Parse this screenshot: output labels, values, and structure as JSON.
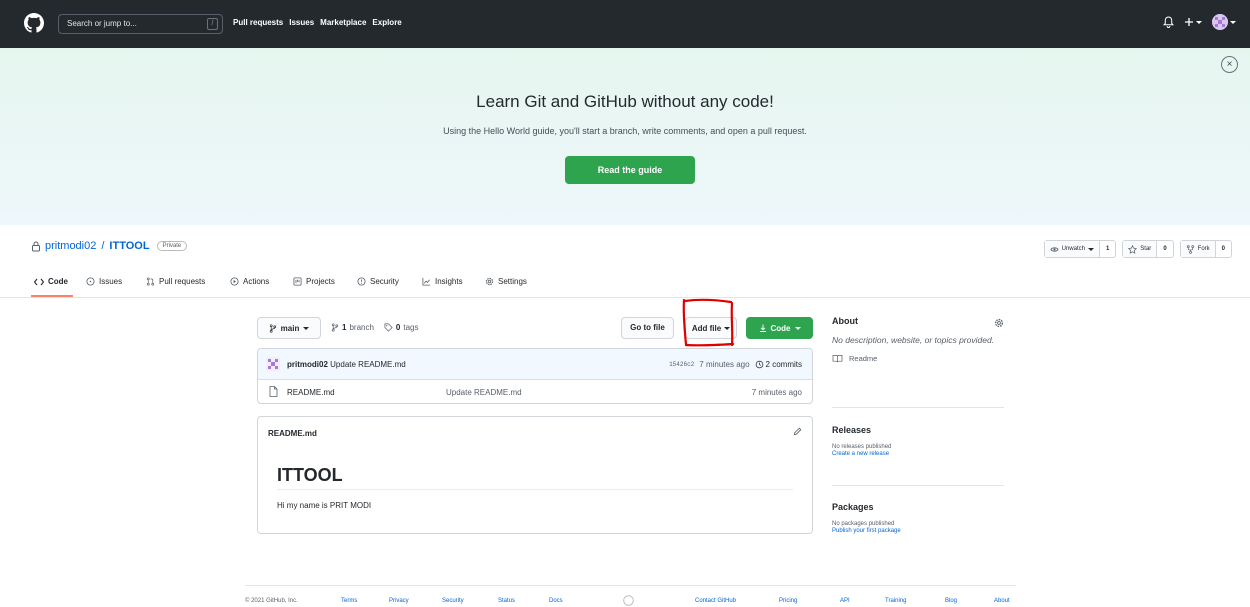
{
  "header": {
    "search_placeholder": "Search or jump to...",
    "search_key": "/",
    "nav": [
      "Pull requests",
      "Issues",
      "Marketplace",
      "Explore"
    ]
  },
  "banner": {
    "title": "Learn Git and GitHub without any code!",
    "subtitle": "Using the Hello World guide, you'll start a branch, write comments, and open a pull request.",
    "button": "Read the guide",
    "close": "×"
  },
  "repo": {
    "owner": "pritmodi02",
    "separator": "/",
    "name": "ITTOOL",
    "visibility": "Private",
    "watch_label": "Unwatch",
    "watch_count": "1",
    "star_label": "Star",
    "star_count": "0",
    "fork_label": "Fork",
    "fork_count": "0"
  },
  "tabs": [
    {
      "label": "Code",
      "icon": "code-icon"
    },
    {
      "label": "Issues",
      "icon": "issue-icon"
    },
    {
      "label": "Pull requests",
      "icon": "pull-request-icon"
    },
    {
      "label": "Actions",
      "icon": "play-icon"
    },
    {
      "label": "Projects",
      "icon": "project-icon"
    },
    {
      "label": "Security",
      "icon": "shield-icon"
    },
    {
      "label": "Insights",
      "icon": "graph-icon"
    },
    {
      "label": "Settings",
      "icon": "gear-icon"
    }
  ],
  "filenav": {
    "branch": "main",
    "branches_count": "1",
    "branches_label": "branch",
    "tags_count": "0",
    "tags_label": "tags",
    "go_to_file": "Go to file",
    "add_file": "Add file",
    "code": "Code"
  },
  "commit": {
    "author": "pritmodi02",
    "message": "Update README.md",
    "sha": "15426c2",
    "time": "7 minutes ago",
    "commits": "2 commits"
  },
  "files": [
    {
      "name": "README.md",
      "message": "Update README.md",
      "time": "7 minutes ago"
    }
  ],
  "readme": {
    "filename": "README.md",
    "heading": "ITTOOL",
    "body": "Hi my name is PRIT MODI"
  },
  "sidebar": {
    "about_title": "About",
    "about_desc": "No description, website, or topics provided.",
    "readme_link": "Readme",
    "releases_title": "Releases",
    "releases_none": "No releases published",
    "releases_create": "Create a new release",
    "packages_title": "Packages",
    "packages_none": "No packages published",
    "packages_publish": "Publish your first package"
  },
  "footer": {
    "copyright": "© 2021 GitHub, Inc.",
    "links": [
      "Terms",
      "Privacy",
      "Security",
      "Status",
      "Docs",
      "Contact GitHub",
      "Pricing",
      "API",
      "Training",
      "Blog",
      "About"
    ]
  },
  "colors": {
    "header_bg": "#24292e",
    "primary_green": "#2ea44f",
    "link_blue": "#0366d6",
    "active_tab": "#f9826c",
    "annotation_red": "#e00000"
  }
}
